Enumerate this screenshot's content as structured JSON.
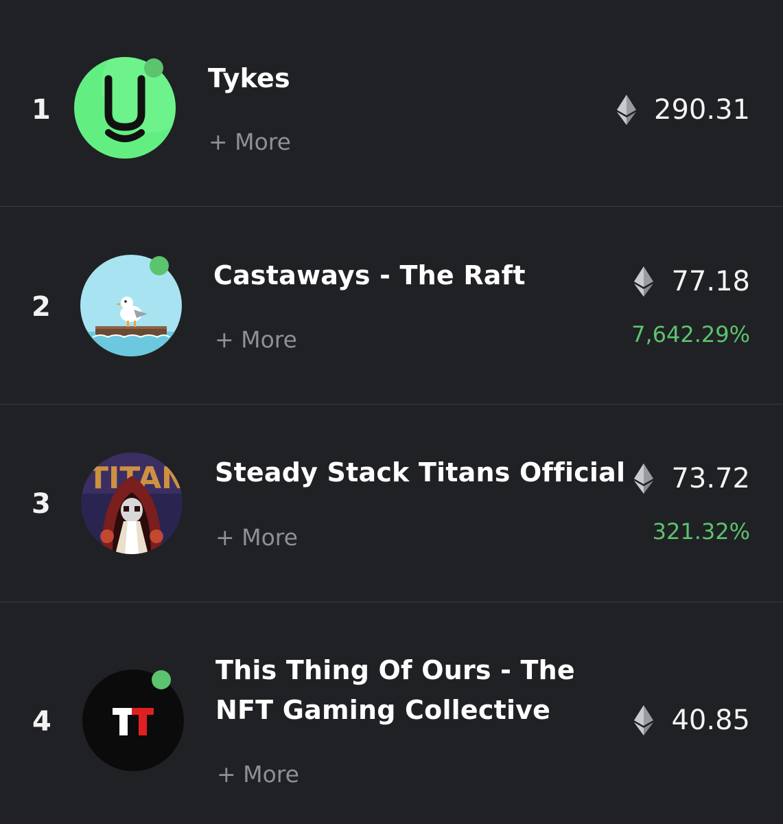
{
  "colors": {
    "background": "#202124",
    "divider": "#3a3b40",
    "positive": "#5cc36e",
    "muted": "#8e9096",
    "online": "#5cc36e"
  },
  "rows": [
    {
      "rank": "1",
      "name": "Tykes",
      "more": "+ More",
      "price": "290.31",
      "change": "",
      "avatar_icon": "tykes-logo",
      "online": true
    },
    {
      "rank": "2",
      "name": "Castaways - The Raft",
      "more": "+ More",
      "price": "77.18",
      "change": "7,642.29%",
      "avatar_icon": "seagull-on-raft",
      "online": true
    },
    {
      "rank": "3",
      "name": "Steady Stack Titans Official",
      "more": "+ More",
      "price": "73.72",
      "change": "321.32%",
      "avatar_icon": "hooded-titan",
      "online": false
    },
    {
      "rank": "4",
      "name_line1": "This Thing Of Ours - The",
      "name_line2": "NFT Gaming Collective",
      "more": "+ More",
      "price": "40.85",
      "change": "",
      "avatar_icon": "tt-logo",
      "online": true
    }
  ],
  "currency_icon": "ethereum-icon"
}
